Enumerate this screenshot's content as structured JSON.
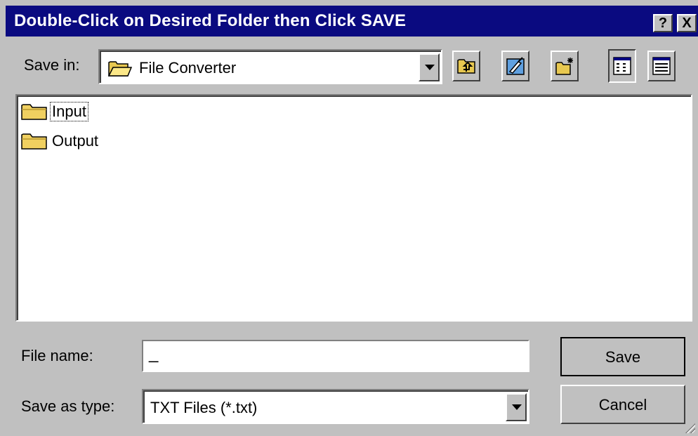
{
  "window": {
    "title": "Double-Click on Desired Folder then Click SAVE",
    "help_label": "?",
    "close_label": "X",
    "title_color": "#0a0a80"
  },
  "save_in": {
    "label": "Save in:",
    "value": "File Converter",
    "icon": "folder-open-icon"
  },
  "toolbar": {
    "buttons": [
      {
        "name": "up-one-level-icon"
      },
      {
        "name": "go-to-desktop-icon"
      },
      {
        "name": "create-new-folder-icon"
      },
      {
        "name": "list-view-icon"
      },
      {
        "name": "details-view-icon"
      }
    ]
  },
  "files": [
    {
      "name": "Input",
      "icon": "folder-icon",
      "focused": true
    },
    {
      "name": "Output",
      "icon": "folder-icon",
      "focused": false
    }
  ],
  "file_name": {
    "label": "File name:",
    "value": "_"
  },
  "save_as_type": {
    "label": "Save as type:",
    "value": "TXT Files (*.txt)"
  },
  "buttons": {
    "save": "Save",
    "cancel": "Cancel"
  }
}
